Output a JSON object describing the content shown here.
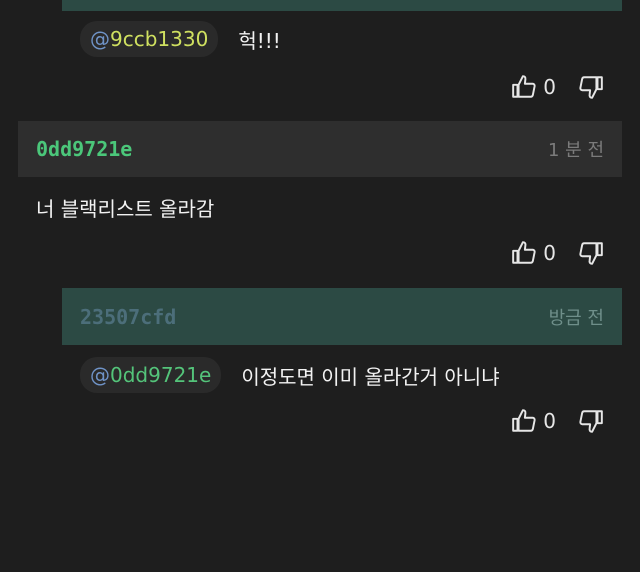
{
  "reply_1": {
    "mention_at": "@",
    "mention_name": "9ccb1330",
    "text": "헉!!!",
    "likes": "0"
  },
  "comment": {
    "author": "0dd9721e",
    "time": "1 분 전",
    "text": "너 블랙리스트 올라감",
    "likes": "0"
  },
  "reply_2": {
    "author": "23507cfd",
    "time": "방금 전",
    "mention_at": "@",
    "mention_name": "0dd9721e",
    "text": "이정도면 이미 올라간거 아니냐",
    "likes": "0"
  },
  "icons": {
    "like": "thumbs-up-icon",
    "dislike": "thumbs-down-icon"
  },
  "colors": {
    "background": "#1e1e1e",
    "reply_header": "#2c4a44",
    "comment_header": "#2e2e2e",
    "author_green": "#4bc77a",
    "mention_yellow": "#cfe060",
    "at_blue": "#6f93c7"
  }
}
